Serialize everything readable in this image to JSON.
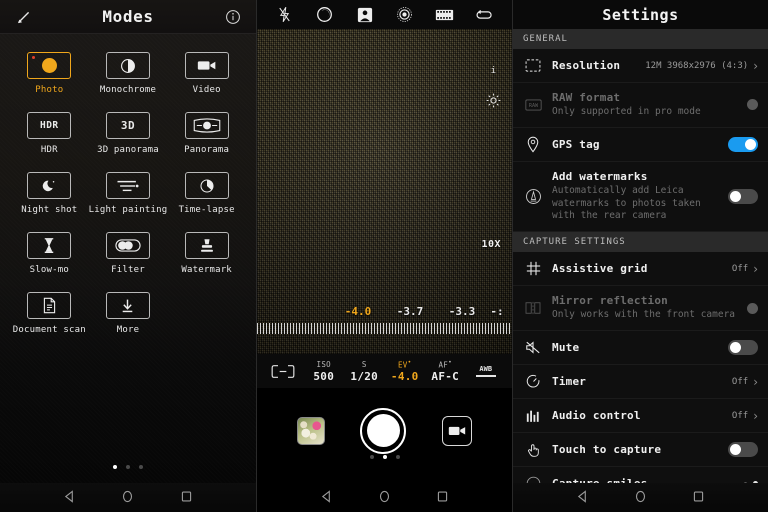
{
  "modes": {
    "header": {
      "title": "Modes",
      "edit_icon": "pencil-icon",
      "info_icon": "info-icon"
    },
    "items": [
      {
        "label": "Photo",
        "icon": "camera-icon",
        "selected": true
      },
      {
        "label": "Monochrome",
        "icon": "contrast-circle-icon",
        "selected": false
      },
      {
        "label": "Video",
        "icon": "video-camera-icon",
        "selected": false
      },
      {
        "label": "HDR",
        "icon": "hdr-text-icon",
        "selected": false
      },
      {
        "label": "3D panorama",
        "icon": "3d-text-icon",
        "selected": false
      },
      {
        "label": "Panorama",
        "icon": "panorama-icon",
        "selected": false
      },
      {
        "label": "Night shot",
        "icon": "moon-icon",
        "selected": false
      },
      {
        "label": "Light painting",
        "icon": "light-streaks-icon",
        "selected": false
      },
      {
        "label": "Time-lapse",
        "icon": "timelapse-icon",
        "selected": false
      },
      {
        "label": "Slow-mo",
        "icon": "hourglass-icon",
        "selected": false
      },
      {
        "label": "Filter",
        "icon": "filter-toggle-icon",
        "selected": false
      },
      {
        "label": "Watermark",
        "icon": "stamp-icon",
        "selected": false
      },
      {
        "label": "Document scan",
        "icon": "document-icon",
        "selected": false
      },
      {
        "label": "More",
        "icon": "download-icon",
        "selected": false
      }
    ],
    "page_dots": {
      "count": 3,
      "active": 0
    }
  },
  "camera": {
    "toolbar": [
      {
        "icon": "flash-off-icon"
      },
      {
        "icon": "aperture-icon"
      },
      {
        "icon": "portrait-icon"
      },
      {
        "icon": "pro-dial-icon"
      },
      {
        "icon": "filmstrip-icon"
      },
      {
        "icon": "loop-icon"
      }
    ],
    "overlay": {
      "info_marker": "i",
      "brightness_icon": "sun-icon",
      "zoom_level": "10X"
    },
    "ev_scale": {
      "values": [
        "-4.0",
        "-3.7",
        "-3.3",
        "-:"
      ],
      "current": "-4.0"
    },
    "pro_controls": [
      {
        "key": "",
        "value": "",
        "icon": "metering-icon",
        "accent": false
      },
      {
        "key": "ISO",
        "value": "500",
        "accent": false
      },
      {
        "key": "S",
        "value": "1/20",
        "accent": false
      },
      {
        "key": "EV",
        "value": "-4.0",
        "accent": true
      },
      {
        "key": "AF",
        "value": "AF-C",
        "accent": false
      },
      {
        "key": "AWB",
        "value": "",
        "icon": "awb-icon",
        "accent": false
      }
    ],
    "bottom": {
      "gallery_thumb": "gallery-thumbnail",
      "shutter": "shutter-button",
      "video_toggle": "video-mode-button",
      "page_dots": {
        "count": 3,
        "active": 1
      }
    }
  },
  "settings": {
    "header": {
      "title": "Settings"
    },
    "sections": [
      {
        "title": "GENERAL",
        "rows": [
          {
            "icon": "resolution-icon",
            "title": "Resolution",
            "subtitle": "",
            "value": "12M 3968x2976 (4:3)",
            "control": "chevron",
            "dim": false
          },
          {
            "icon": "raw-icon",
            "title": "RAW format",
            "subtitle": "Only supported in pro mode",
            "value": "",
            "control": "dot-disabled",
            "dim": true
          },
          {
            "icon": "location-pin-icon",
            "title": "GPS tag",
            "subtitle": "",
            "value": "",
            "control": "toggle-on",
            "dim": false
          },
          {
            "icon": "watermark-icon",
            "title": "Add watermarks",
            "subtitle": "Automatically add Leica watermarks to photos taken with the rear camera",
            "value": "",
            "control": "toggle-off",
            "dim": false
          }
        ]
      },
      {
        "title": "CAPTURE SETTINGS",
        "rows": [
          {
            "icon": "grid-icon",
            "title": "Assistive grid",
            "subtitle": "",
            "value": "Off",
            "control": "chevron",
            "dim": false
          },
          {
            "icon": "mirror-icon",
            "title": "Mirror reflection",
            "subtitle": "Only works with the front camera",
            "value": "",
            "control": "dot-disabled",
            "dim": true
          },
          {
            "icon": "mute-icon",
            "title": "Mute",
            "subtitle": "",
            "value": "",
            "control": "toggle-off",
            "dim": false
          },
          {
            "icon": "timer-icon",
            "title": "Timer",
            "subtitle": "",
            "value": "Off",
            "control": "chevron",
            "dim": false
          },
          {
            "icon": "audio-bars-icon",
            "title": "Audio control",
            "subtitle": "",
            "value": "Off",
            "control": "chevron",
            "dim": false
          },
          {
            "icon": "touch-hand-icon",
            "title": "Touch to capture",
            "subtitle": "",
            "value": "",
            "control": "toggle-off",
            "dim": false
          },
          {
            "icon": "smile-icon",
            "title": "Capture smiles",
            "subtitle": "",
            "value": "",
            "control": "smile-dots",
            "dim": false
          }
        ]
      }
    ]
  },
  "navbar": {
    "back": "back-triangle-icon",
    "home": "home-circle-icon",
    "recents": "recents-square-icon"
  },
  "colors": {
    "accent": "#f0a71c",
    "toggle_on": "#1a9bf0",
    "text": "#f0f0f0",
    "muted": "#6d6d6d"
  }
}
